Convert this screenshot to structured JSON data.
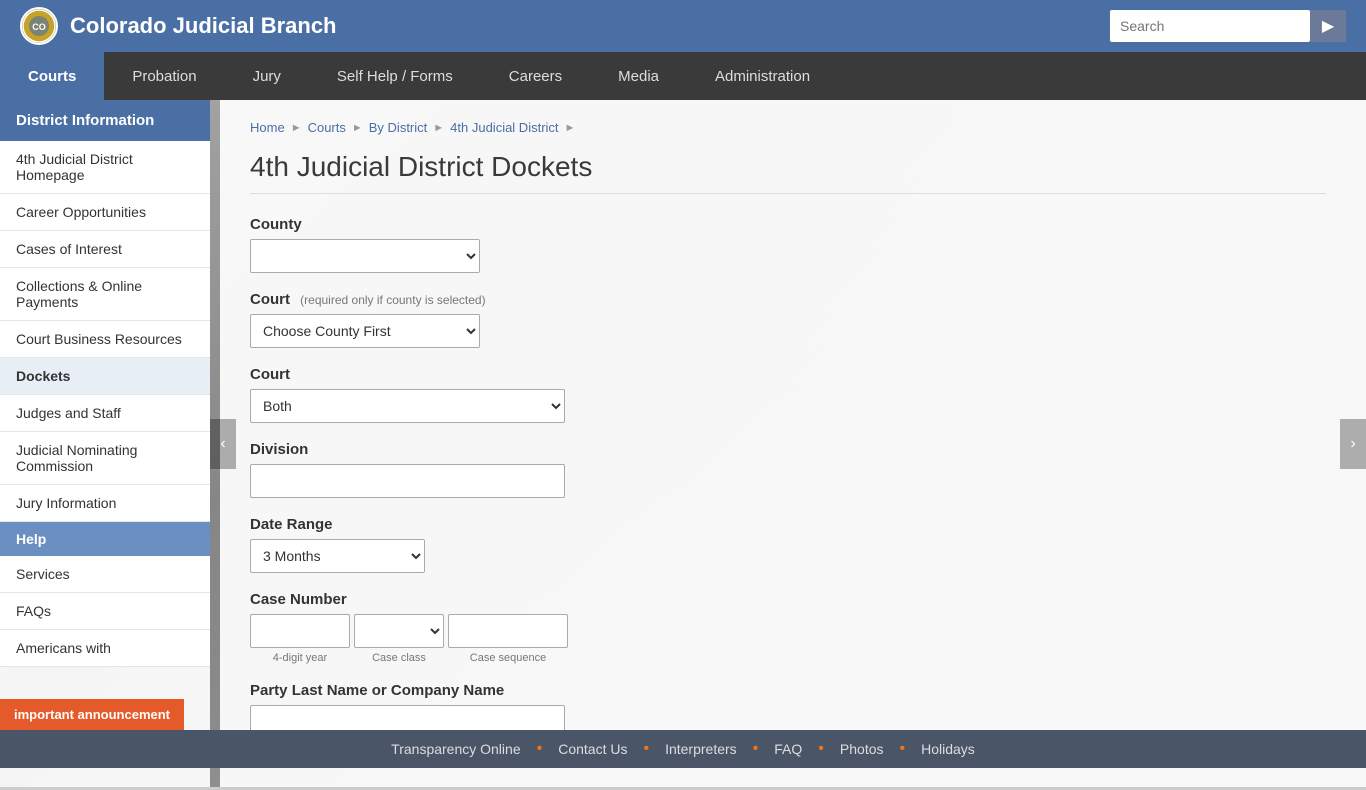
{
  "header": {
    "logo_text": "CO",
    "title": "Colorado Judicial Branch",
    "search_placeholder": "Search",
    "search_btn_icon": "▶"
  },
  "nav": {
    "items": [
      {
        "label": "Courts",
        "active": true
      },
      {
        "label": "Probation",
        "active": false
      },
      {
        "label": "Jury",
        "active": false
      },
      {
        "label": "Self Help / Forms",
        "active": false
      },
      {
        "label": "Careers",
        "active": false
      },
      {
        "label": "Media",
        "active": false
      },
      {
        "label": "Administration",
        "active": false
      }
    ]
  },
  "sidebar": {
    "section_title": "District Information",
    "items": [
      {
        "label": "4th Judicial District Homepage",
        "active": false
      },
      {
        "label": "Career Opportunities",
        "active": false
      },
      {
        "label": "Cases of Interest",
        "active": false
      },
      {
        "label": "Collections & Online Payments",
        "active": false
      },
      {
        "label": "Court Business Resources",
        "active": false
      },
      {
        "label": "Dockets",
        "active": true
      },
      {
        "label": "Judges and Staff",
        "active": false
      },
      {
        "label": "Judicial Nominating Commission",
        "active": false
      },
      {
        "label": "Jury Information",
        "active": false
      }
    ],
    "help_section": "Help",
    "help_items": [
      {
        "label": "Services",
        "active": false
      },
      {
        "label": "FAQs",
        "active": false
      },
      {
        "label": "Americans with",
        "active": false
      }
    ]
  },
  "breadcrumb": {
    "items": [
      {
        "label": "Home"
      },
      {
        "label": "Courts"
      },
      {
        "label": "By District"
      },
      {
        "label": "4th Judicial District"
      }
    ]
  },
  "page": {
    "title": "4th Judicial District Dockets",
    "county_label": "County",
    "court_label": "Court",
    "court_note": "(required only if county is selected)",
    "court_choose_first": "Choose County First",
    "court2_label": "Court",
    "court2_default": "Both",
    "division_label": "Division",
    "date_range_label": "Date Range",
    "date_range_default": "3 Months",
    "case_number_label": "Case Number",
    "case_4digit_label": "4-digit year",
    "case_class_label": "Case class",
    "case_seq_label": "Case sequence",
    "party_label": "Party Last Name or Company Name"
  },
  "footer": {
    "links": [
      "Transparency Online",
      "Contact Us",
      "Interpreters",
      "FAQ",
      "Photos",
      "Holidays"
    ],
    "important": "important announcement"
  }
}
